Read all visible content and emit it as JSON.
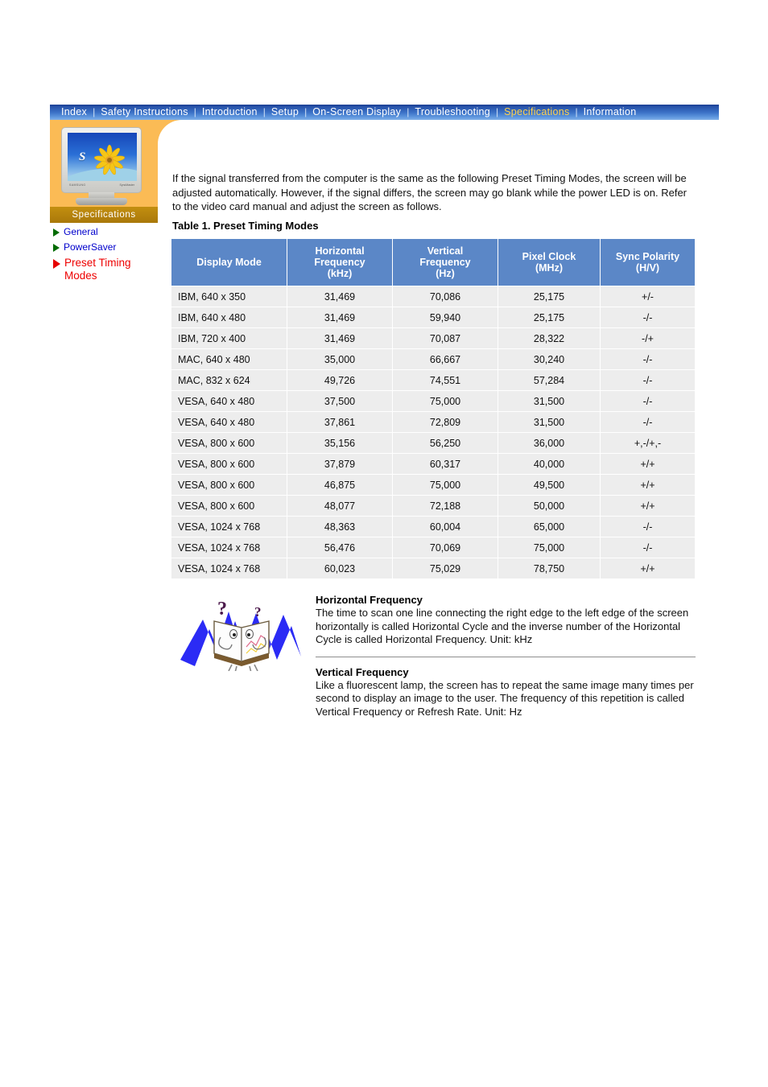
{
  "nav": {
    "separator": "|",
    "items": [
      {
        "label": "Index",
        "active": false
      },
      {
        "label": "Safety Instructions",
        "active": false
      },
      {
        "label": "Introduction",
        "active": false
      },
      {
        "label": "Setup",
        "active": false
      },
      {
        "label": "On-Screen Display",
        "active": false
      },
      {
        "label": "Troubleshooting",
        "active": false
      },
      {
        "label": "Specifications",
        "active": true
      },
      {
        "label": "Information",
        "active": false
      }
    ],
    "active_color": "#ffd24d",
    "bar_color": "#3c72c8"
  },
  "sidebar": {
    "panel_color": "#fbbb55",
    "tab_label": "Specifications",
    "tab_color": "#b8860b",
    "monitor": {
      "brand": "SAMSUNG",
      "model": "SyncMaster",
      "screen_letter": "S"
    },
    "links": [
      {
        "label": "General",
        "state": "normal",
        "marker": "green-triangle-icon"
      },
      {
        "label": "PowerSaver",
        "state": "normal",
        "marker": "green-triangle-icon"
      },
      {
        "label": "Preset Timing Modes",
        "state": "current",
        "marker": "red-triangle-icon"
      }
    ]
  },
  "main": {
    "intro": "If the signal transferred from the computer is the same as the following Preset Timing Modes, the screen will be adjusted automatically. However, if the signal differs, the screen may go blank while the power LED is on. Refer to the video card manual and adjust the screen as follows.",
    "table_caption": "Table 1. Preset Timing Modes"
  },
  "table": {
    "header_color": "#5b87c7",
    "row_color": "#ededed",
    "columns": [
      "Display Mode",
      "Horizontal Frequency (kHz)",
      "Vertical Frequency (Hz)",
      "Pixel Clock (MHz)",
      "Sync Polarity (H/V)"
    ],
    "columns_lines": [
      [
        "Display Mode"
      ],
      [
        "Horizontal",
        "Frequency",
        "(kHz)"
      ],
      [
        "Vertical",
        "Frequency",
        "(Hz)"
      ],
      [
        "Pixel Clock",
        "(MHz)"
      ],
      [
        "Sync Polarity",
        "(H/V)"
      ]
    ],
    "rows": [
      [
        "IBM, 640 x 350",
        "31,469",
        "70,086",
        "25,175",
        "+/-"
      ],
      [
        "IBM, 640 x 480",
        "31,469",
        "59,940",
        "25,175",
        "-/-"
      ],
      [
        "IBM, 720 x 400",
        "31,469",
        "70,087",
        "28,322",
        "-/+"
      ],
      [
        "MAC, 640 x 480",
        "35,000",
        "66,667",
        "30,240",
        "-/-"
      ],
      [
        "MAC, 832 x 624",
        "49,726",
        "74,551",
        "57,284",
        "-/-"
      ],
      [
        "VESA, 640 x 480",
        "37,500",
        "75,000",
        "31,500",
        "-/-"
      ],
      [
        "VESA, 640 x 480",
        "37,861",
        "72,809",
        "31,500",
        "-/-"
      ],
      [
        "VESA, 800 x 600",
        "35,156",
        "56,250",
        "36,000",
        "+,-/+,-"
      ],
      [
        "VESA, 800 x 600",
        "37,879",
        "60,317",
        "40,000",
        "+/+"
      ],
      [
        "VESA, 800 x 600",
        "46,875",
        "75,000",
        "49,500",
        "+/+"
      ],
      [
        "VESA, 800 x 600",
        "48,077",
        "72,188",
        "50,000",
        "+/+"
      ],
      [
        "VESA, 1024 x 768",
        "48,363",
        "60,004",
        "65,000",
        "-/-"
      ],
      [
        "VESA, 1024 x 768",
        "56,476",
        "70,069",
        "75,000",
        "-/-"
      ],
      [
        "VESA, 1024 x 768",
        "60,023",
        "75,029",
        "78,750",
        "+/+"
      ]
    ]
  },
  "notes": {
    "icon_name": "open-book-question-icon",
    "horizontal": {
      "title": "Horizontal Frequency",
      "body": "The time to scan one line connecting the right edge to the left edge of the screen horizontally is called Horizontal Cycle and the inverse number of the Horizontal Cycle is called Horizontal Frequency. Unit: kHz"
    },
    "vertical": {
      "title": "Vertical Frequency",
      "body": "Like a fluorescent lamp, the screen has to repeat the same image many times per second to display an image to the user. The frequency of this repetition is called Vertical Frequency or Refresh Rate. Unit: Hz"
    }
  }
}
